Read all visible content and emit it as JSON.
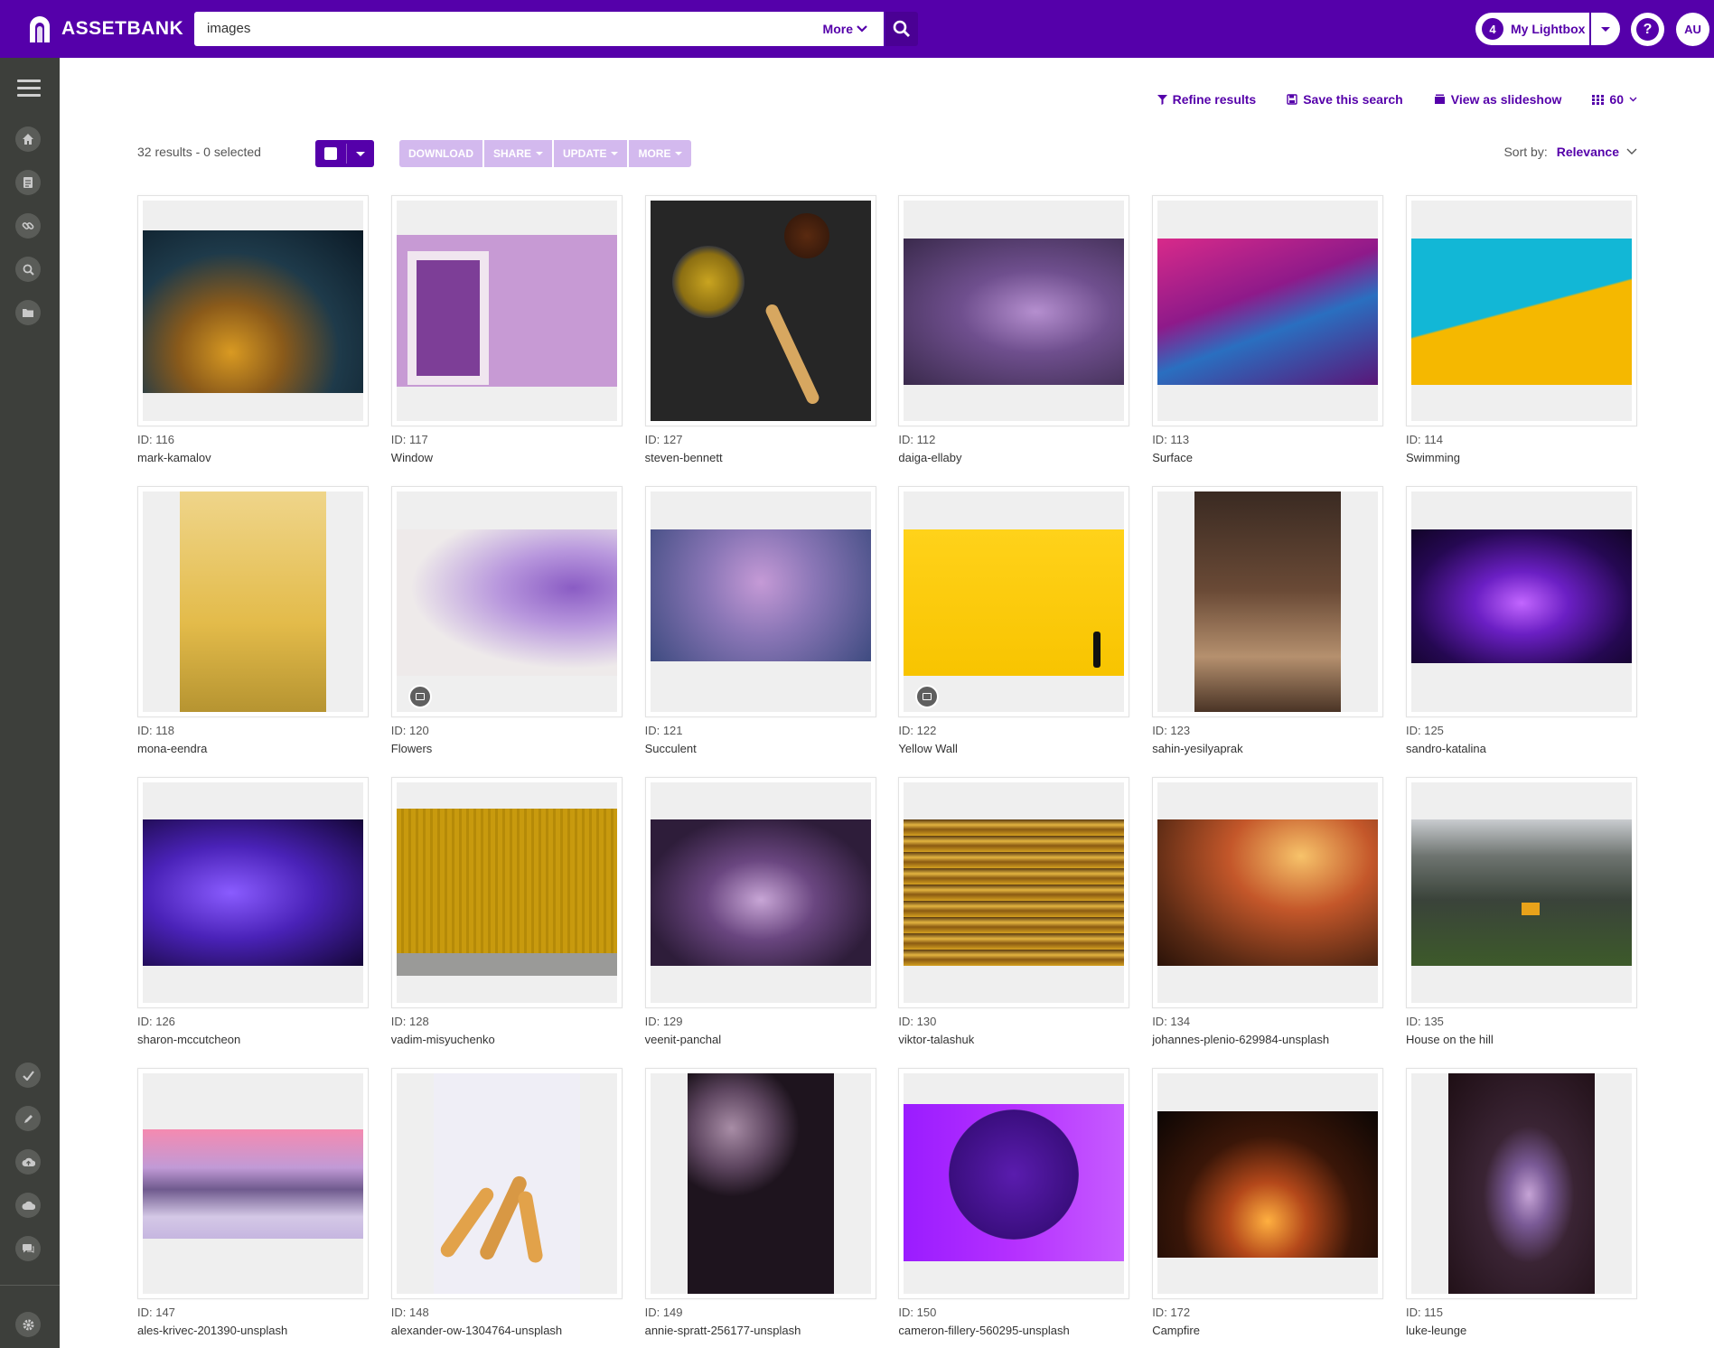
{
  "header": {
    "brand": "ASSETBANK",
    "search": {
      "value": "images",
      "more_label": "More"
    },
    "lightbox": {
      "count": "4",
      "label": "My Lightbox"
    },
    "help": "?",
    "avatar": "AU"
  },
  "sidebar": {
    "icons": [
      "menu-icon",
      "home-icon",
      "document-icon",
      "link-icon",
      "search-icon",
      "folder-icon",
      "check-icon",
      "pencil-icon",
      "upload-icon",
      "cloud-icon",
      "chat-icon",
      "settings-icon"
    ]
  },
  "utility": {
    "refine": "Refine results",
    "save_search": "Save this search",
    "slideshow": "View as slideshow",
    "per_page": "60"
  },
  "actions": {
    "count_text": "32 results -  0 selected",
    "download": "DOWNLOAD",
    "share": "SHARE",
    "update": "UPDATE",
    "more": "MORE",
    "sort_label": "Sort by:",
    "sort_value": "Relevance"
  },
  "colors": {
    "brand": "#5500aa",
    "sidebar": "#3d3f3b",
    "action_disabled": "#d3b9ee"
  },
  "assets": [
    {
      "id": "ID: 116",
      "name": "mark-kamalov"
    },
    {
      "id": "ID: 117",
      "name": "Window"
    },
    {
      "id": "ID: 127",
      "name": "steven-bennett"
    },
    {
      "id": "ID: 112",
      "name": "daiga-ellaby"
    },
    {
      "id": "ID: 113",
      "name": "Surface"
    },
    {
      "id": "ID: 114",
      "name": "Swimming"
    },
    {
      "id": "ID: 118",
      "name": "mona-eendra"
    },
    {
      "id": "ID: 120",
      "name": "Flowers"
    },
    {
      "id": "ID: 121",
      "name": "Succulent"
    },
    {
      "id": "ID: 122",
      "name": "Yellow Wall"
    },
    {
      "id": "ID: 123",
      "name": "sahin-yesilyaprak"
    },
    {
      "id": "ID: 125",
      "name": "sandro-katalina"
    },
    {
      "id": "ID: 126",
      "name": "sharon-mccutcheon"
    },
    {
      "id": "ID: 128",
      "name": "vadim-misyuchenko"
    },
    {
      "id": "ID: 129",
      "name": "veenit-panchal"
    },
    {
      "id": "ID: 130",
      "name": "viktor-talashuk"
    },
    {
      "id": "ID: 134",
      "name": "johannes-plenio-629984-unsplash"
    },
    {
      "id": "ID: 135",
      "name": "House on the hill"
    },
    {
      "id": "ID: 147",
      "name": "ales-krivec-201390-unsplash"
    },
    {
      "id": "ID: 148",
      "name": "alexander-ow-1304764-unsplash"
    },
    {
      "id": "ID: 149",
      "name": "annie-spratt-256177-unsplash"
    },
    {
      "id": "ID: 150",
      "name": "cameron-fillery-560295-unsplash"
    },
    {
      "id": "ID: 172",
      "name": "Campfire"
    },
    {
      "id": "ID: 115",
      "name": "luke-leunge"
    }
  ]
}
